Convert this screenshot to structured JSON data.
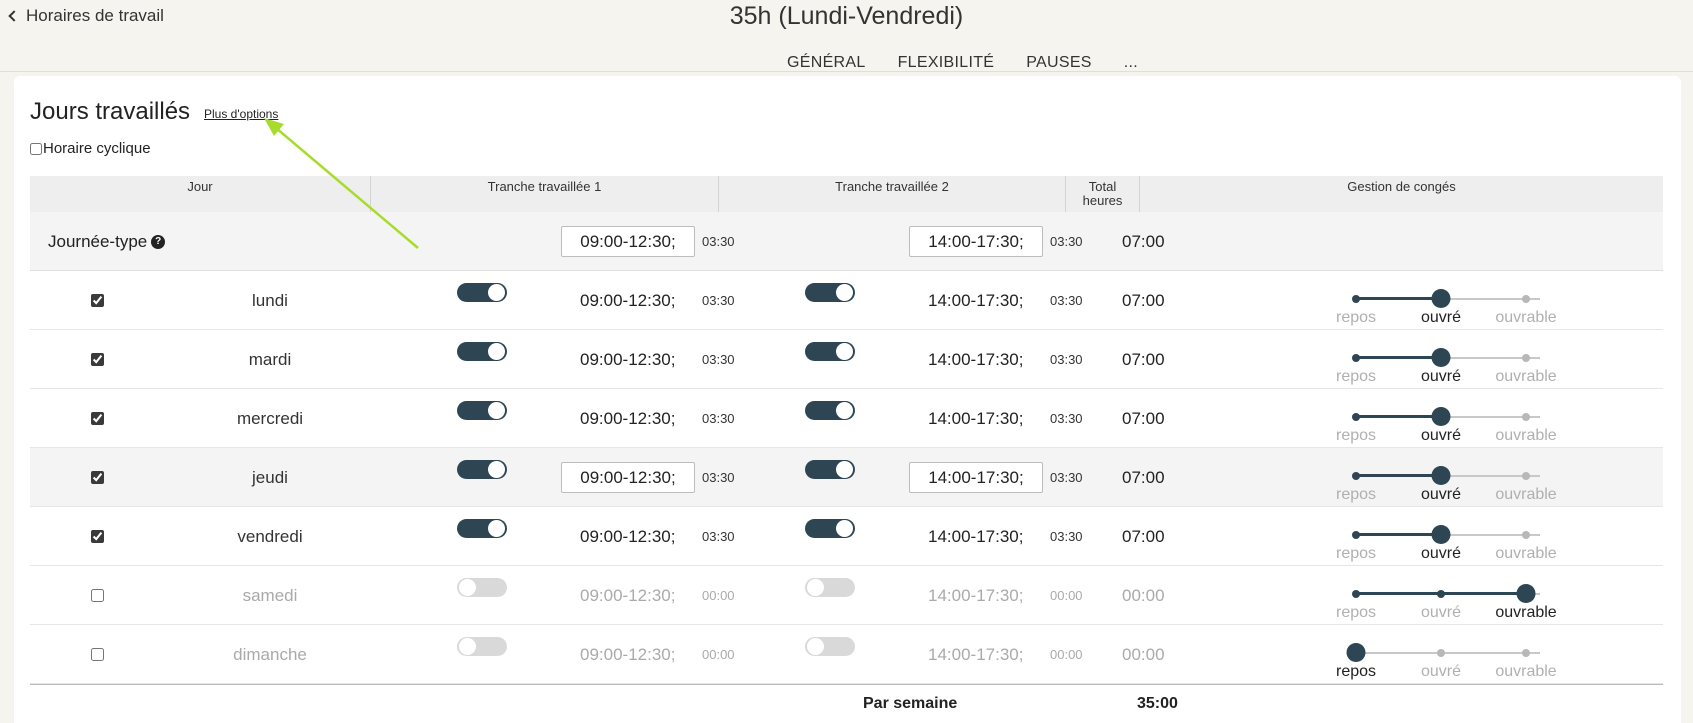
{
  "header": {
    "back_label": "Horaires de travail",
    "title": "35h (Lundi-Vendredi)",
    "tabs": [
      "GÉNÉRAL",
      "FLEXIBILITÉ",
      "PAUSES",
      "..."
    ]
  },
  "section": {
    "title": "Jours travaillés",
    "more_options": "Plus d'options",
    "cyclic_label": "Horaire cyclique"
  },
  "columns": {
    "day": "Jour",
    "slot1": "Tranche travaillée 1",
    "slot2": "Tranche travaillée 2",
    "total_line1": "Total",
    "total_line2": "heures",
    "leave": "Gestion de congés"
  },
  "typical": {
    "label": "Journée-type",
    "help_icon": "?",
    "slot1": "09:00-12:30;",
    "dur1": "03:30",
    "slot2": "14:00-17:30;",
    "dur2": "03:30",
    "total": "07:00"
  },
  "leave_labels": [
    "repos",
    "ouvré",
    "ouvrable"
  ],
  "days": [
    {
      "name": "lundi",
      "checked": true,
      "on": true,
      "slot1": "09:00-12:30;",
      "dur1": "03:30",
      "slot2": "14:00-17:30;",
      "dur2": "03:30",
      "total": "07:00",
      "leave": 1,
      "editable": false
    },
    {
      "name": "mardi",
      "checked": true,
      "on": true,
      "slot1": "09:00-12:30;",
      "dur1": "03:30",
      "slot2": "14:00-17:30;",
      "dur2": "03:30",
      "total": "07:00",
      "leave": 1,
      "editable": false
    },
    {
      "name": "mercredi",
      "checked": true,
      "on": true,
      "slot1": "09:00-12:30;",
      "dur1": "03:30",
      "slot2": "14:00-17:30;",
      "dur2": "03:30",
      "total": "07:00",
      "leave": 1,
      "editable": false
    },
    {
      "name": "jeudi",
      "checked": true,
      "on": true,
      "slot1": "09:00-12:30;",
      "dur1": "03:30",
      "slot2": "14:00-17:30;",
      "dur2": "03:30",
      "total": "07:00",
      "leave": 1,
      "editable": true
    },
    {
      "name": "vendredi",
      "checked": true,
      "on": true,
      "slot1": "09:00-12:30;",
      "dur1": "03:30",
      "slot2": "14:00-17:30;",
      "dur2": "03:30",
      "total": "07:00",
      "leave": 1,
      "editable": false
    },
    {
      "name": "samedi",
      "checked": false,
      "on": false,
      "slot1": "09:00-12:30;",
      "dur1": "00:00",
      "slot2": "14:00-17:30;",
      "dur2": "00:00",
      "total": "00:00",
      "leave": 2,
      "editable": false
    },
    {
      "name": "dimanche",
      "checked": false,
      "on": false,
      "slot1": "09:00-12:30;",
      "dur1": "00:00",
      "slot2": "14:00-17:30;",
      "dur2": "00:00",
      "total": "00:00",
      "leave": 0,
      "editable": false
    }
  ],
  "footer": {
    "week_label": "Par semaine",
    "week_total": "35:00"
  },
  "colors": {
    "accent": "#2e4653",
    "annotation_arrow": "#a8dc2c"
  }
}
